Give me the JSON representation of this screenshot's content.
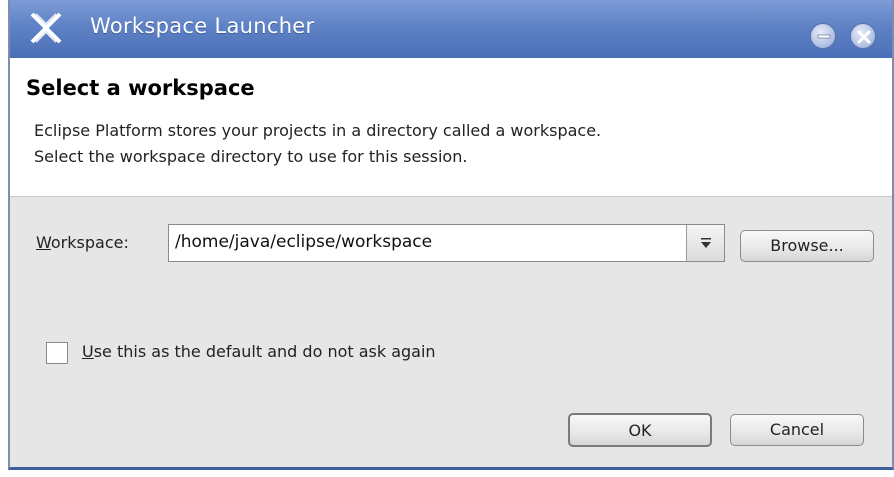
{
  "window": {
    "title": "Workspace Launcher",
    "app_icon": "eclipse-icon",
    "controls": {
      "minimize_icon": "minimize-icon",
      "close_icon": "close-icon"
    }
  },
  "header": {
    "title": "Select a workspace",
    "line1": "Eclipse Platform stores your projects in a directory called a workspace.",
    "line2": "Select the workspace directory to use for this session."
  },
  "workspace": {
    "label_mnemonic": "W",
    "label_rest": "orkspace:",
    "value": "/home/java/eclipse/workspace",
    "dropdown_icon": "dropdown-arrow-icon",
    "browse_label": "Browse..."
  },
  "default_option": {
    "checked": false,
    "label_mnemonic": "U",
    "label_rest": "se this as the default and do not ask again"
  },
  "buttons": {
    "ok_label": "OK",
    "cancel_label": "Cancel"
  },
  "colors": {
    "titlebar": "#5f82c6",
    "dialog_background": "#e6e6e6",
    "header_background": "#ffffff"
  }
}
